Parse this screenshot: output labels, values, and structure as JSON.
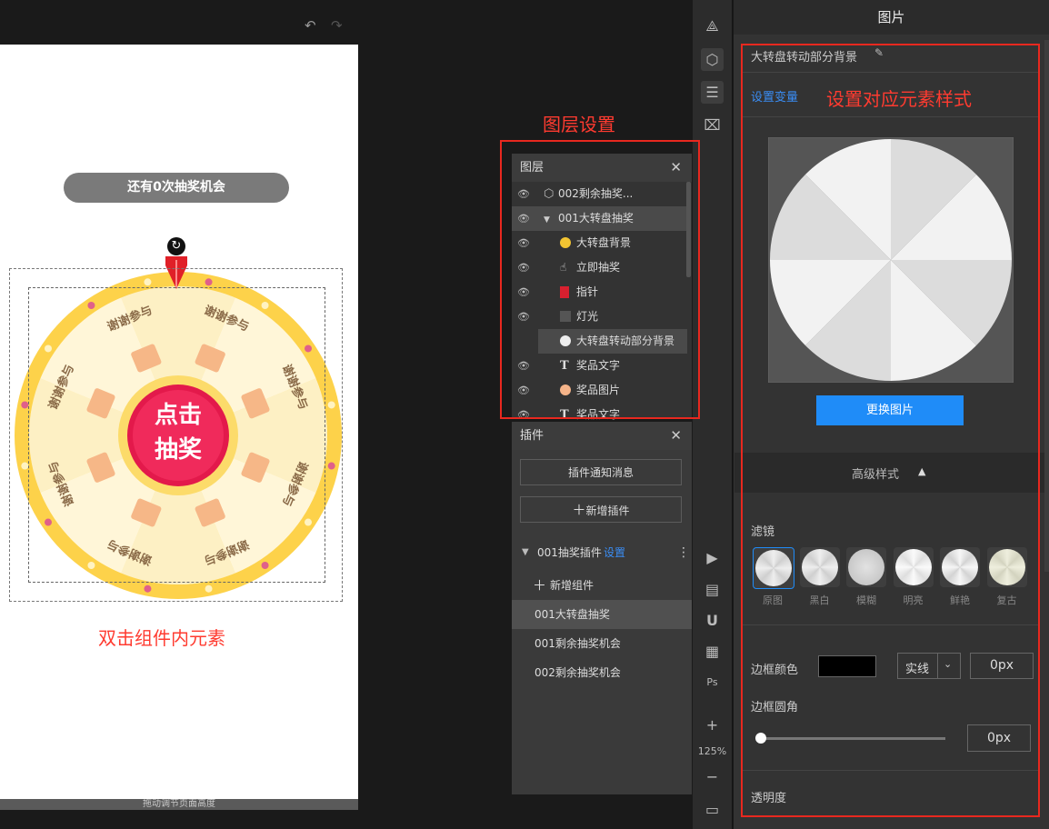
{
  "canvas": {
    "undo_icon": "↶",
    "redo_icon": "↷",
    "chance_text": "还有0次抽奖机会",
    "center_button": [
      "点击",
      "抽奖"
    ],
    "segment_text": "谢谢参与",
    "bottom_hint": "拖动调节页面高度",
    "annotation_dblclick": "双击组件内元素",
    "annotation_layers": "图层设置"
  },
  "layers": {
    "title": "图层",
    "close": "✕",
    "items": [
      {
        "label": "002剩余抽奖...",
        "indent": 0,
        "icon": "cube-icon",
        "highlight": false
      },
      {
        "label": "001大转盘抽奖",
        "indent": 0,
        "icon": "caret-down-icon",
        "highlight": true
      },
      {
        "label": "大转盘背景",
        "indent": 1,
        "icon": "yellow-circle-icon",
        "highlight": false
      },
      {
        "label": "立即抽奖",
        "indent": 1,
        "icon": "hand-icon",
        "highlight": false
      },
      {
        "label": "指针",
        "indent": 1,
        "icon": "red-pointer-icon",
        "highlight": false
      },
      {
        "label": "灯光",
        "indent": 1,
        "icon": "gray-square-icon",
        "highlight": false
      },
      {
        "label": "大转盘转动部分背景",
        "indent": 1,
        "icon": "white-circle-icon",
        "highlight": true
      },
      {
        "label": "奖品文字",
        "indent": 1,
        "icon": "text-icon",
        "highlight": false
      },
      {
        "label": "奖品图片",
        "indent": 1,
        "icon": "gift-icon",
        "highlight": false
      },
      {
        "label": "奖品文字",
        "indent": 1,
        "icon": "text-icon",
        "highlight": false
      }
    ]
  },
  "plugins": {
    "title": "插件",
    "close": "✕",
    "notify_btn": "插件通知消息",
    "add_plugin_btn": "新增插件",
    "group_label": "001抽奖插件",
    "group_setting": "设置",
    "add_component": "新增组件",
    "components": [
      "001大转盘抽奖",
      "001剩余抽奖机会",
      "002剩余抽奖机会"
    ]
  },
  "toolbar": {
    "zoom": "125%",
    "plus": "+",
    "minus": "−"
  },
  "props": {
    "panel_title": "图片",
    "element_name": "大转盘转动部分背景",
    "set_variable": "设置变量",
    "annotation_style": "设置对应元素样式",
    "replace_image_btn": "更换图片",
    "advanced_style": "高级样式",
    "filter_label": "滤镜",
    "filters": [
      "原图",
      "黑白",
      "模糊",
      "明亮",
      "鲜艳",
      "复古"
    ],
    "border_color_label": "边框颜色",
    "border_color": "#000000",
    "border_style": "实线",
    "border_width": "0px",
    "border_radius_label": "边框圆角",
    "border_radius_value": "0px",
    "border_radius_level": 0,
    "opacity_label": "透明度"
  }
}
